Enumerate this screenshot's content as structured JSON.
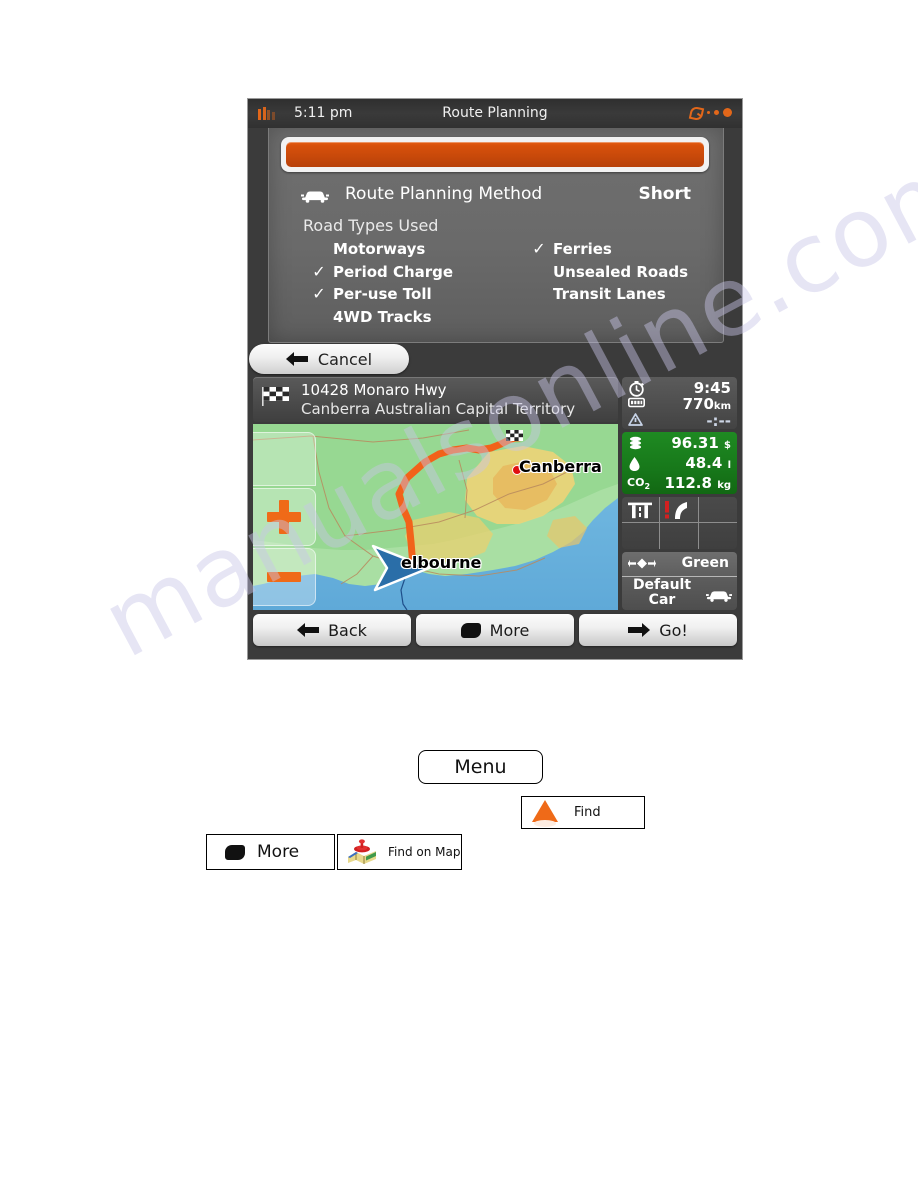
{
  "device": {
    "statusbar": {
      "time": "5:11 pm",
      "title": "Route Planning",
      "signal_icon": "signal-bars-icon",
      "gps_icon": "satellite-dish-icon"
    },
    "route_planning_panel": {
      "progress_label": "progress-bar",
      "method_icon": "car-icon",
      "method_label": "Route Planning Method",
      "method_value": "Short",
      "road_types_title": "Road Types Used",
      "road_types_left": [
        {
          "label": "Motorways",
          "checked": false
        },
        {
          "label": "Period Charge",
          "checked": true
        },
        {
          "label": "Per-use Toll",
          "checked": true
        },
        {
          "label": "4WD Tracks",
          "checked": false
        }
      ],
      "road_types_right": [
        {
          "label": "Ferries",
          "checked": true
        },
        {
          "label": "Unsealed Roads",
          "checked": false
        },
        {
          "label": "Transit Lanes",
          "checked": false
        }
      ],
      "check_glyph": "✓"
    },
    "cancel_button": {
      "label": "Cancel",
      "icon": "arrow-left-icon"
    },
    "address_bar": {
      "icon": "checkered-flag-icon",
      "line1": "10428 Monaro Hwy",
      "line2": "Canberra Australian Capital Territory"
    },
    "map": {
      "zoom_in_icon": "plus-icon",
      "zoom_out_icon": "minus-icon",
      "labels": [
        {
          "name": "Canberra",
          "type": "destination-city"
        },
        {
          "name": "elbourne",
          "type": "origin-city"
        }
      ],
      "route_color": "#f2621a",
      "position_marker": "vehicle-arrow-icon",
      "destination_marker": "checkered-flag-icon"
    },
    "info_panel": {
      "eta": {
        "time_icon": "clock-icon",
        "time_value": "9:45",
        "distance_icon": "distance-icon",
        "distance_value": "770",
        "distance_unit": "km",
        "warning_icon": "alert-icon",
        "warning_value": "-:--"
      },
      "cost": {
        "money_icon": "coins-icon",
        "money_value": "96.31",
        "money_unit": "$",
        "fuel_icon": "fuel-drop-icon",
        "fuel_value": "48.4",
        "fuel_unit": "l",
        "co2_label": "CO",
        "co2_sub": "2",
        "co2_value": "112.8",
        "co2_unit": "kg"
      },
      "road_icons": [
        "motorway-icon",
        "warning-curve-icon"
      ],
      "route_mode": {
        "icon": "route-alt-icon",
        "label": "Green"
      },
      "vehicle": {
        "label_line1": "Default",
        "label_line2": "Car",
        "icon": "car-icon"
      }
    },
    "bottom_buttons": [
      {
        "label": "Back",
        "icon": "arrow-left-icon"
      },
      {
        "label": "More",
        "icon": "more-rounded-icon"
      },
      {
        "label": "Go!",
        "icon": "arrow-right-icon"
      }
    ]
  },
  "doc_buttons": {
    "menu": {
      "label": "Menu"
    },
    "find": {
      "label": "Find",
      "icon": "orange-cone-icon"
    },
    "more": {
      "label": "More",
      "icon": "more-rounded-icon"
    },
    "find_on_map": {
      "label": "Find on Map",
      "icon": "map-pin-icon"
    }
  }
}
